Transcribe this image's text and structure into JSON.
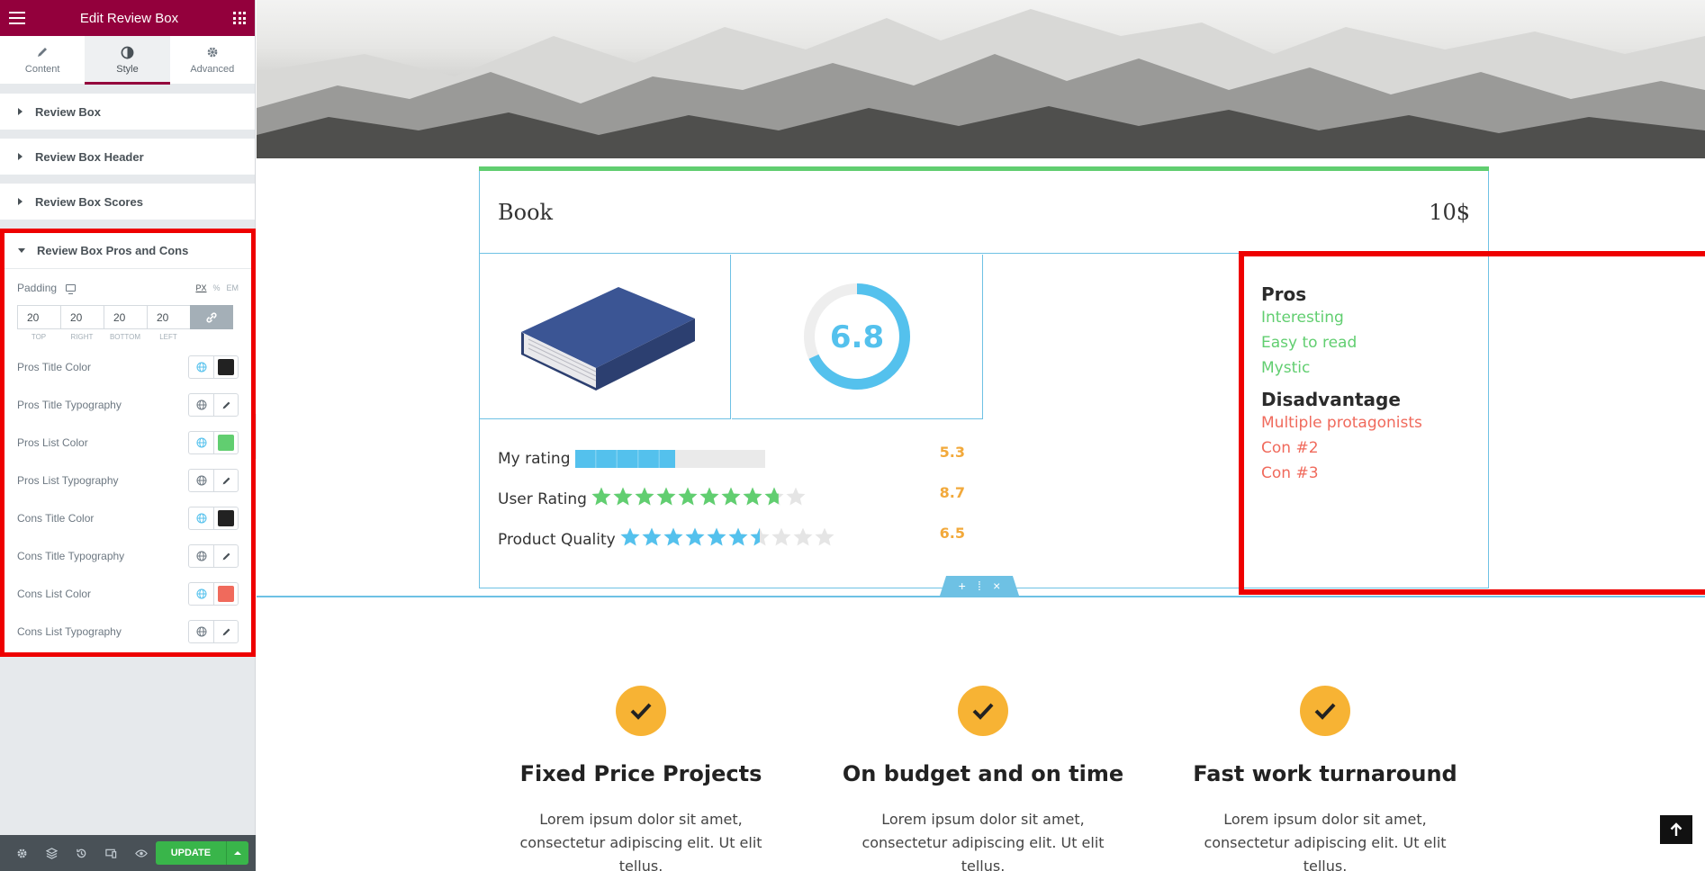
{
  "sidebar": {
    "title": "Edit Review Box",
    "tabs": [
      {
        "label": "Content",
        "icon": "pencil-icon"
      },
      {
        "label": "Style",
        "icon": "contrast-icon"
      },
      {
        "label": "Advanced",
        "icon": "gear-icon"
      }
    ],
    "sections": [
      "Review Box",
      "Review Box Header",
      "Review Box Scores"
    ],
    "open_section": {
      "title": "Review Box Pros and Cons",
      "padding": {
        "label": "Padding",
        "units": [
          "PX",
          "%",
          "EM"
        ],
        "values": [
          "20",
          "20",
          "20",
          "20"
        ],
        "labels": [
          "TOP",
          "RIGHT",
          "BOTTOM",
          "LEFT"
        ]
      },
      "controls": [
        {
          "label": "Pros Title Color",
          "type": "color",
          "color": "#222222"
        },
        {
          "label": "Pros Title Typography",
          "type": "typography"
        },
        {
          "label": "Pros List Color",
          "type": "color",
          "color": "#61ce70"
        },
        {
          "label": "Pros List Typography",
          "type": "typography"
        },
        {
          "label": "Cons Title Color",
          "type": "color",
          "color": "#222222"
        },
        {
          "label": "Cons Title Typography",
          "type": "typography"
        },
        {
          "label": "Cons List Color",
          "type": "color",
          "color": "#f06a5c"
        },
        {
          "label": "Cons List Typography",
          "type": "typography"
        }
      ]
    },
    "footer": {
      "update_label": "UPDATE"
    }
  },
  "review": {
    "title": "Book",
    "price": "10$",
    "score": "6.8",
    "score_fraction": 0.68,
    "ratings": [
      {
        "label": "My rating",
        "value": "5.3",
        "type": "bar",
        "fraction": 0.53
      },
      {
        "label": "User Rating",
        "value": "8.7",
        "type": "stars",
        "color": "#61ce70",
        "stars": 8.7
      },
      {
        "label": "Product Quality",
        "value": "6.5",
        "type": "stars",
        "color": "#54c1ed",
        "stars": 6.5
      }
    ],
    "pros": {
      "title": "Pros",
      "items": [
        "Interesting",
        "Easy to read",
        "Mystic"
      ]
    },
    "cons": {
      "title": "Disadvantage",
      "items": [
        "Multiple protagonists",
        "Con #2",
        "Con #3"
      ]
    }
  },
  "features": [
    {
      "title": "Fixed Price Projects",
      "text": "Lorem ipsum dolor sit amet, consectetur adipiscing elit. Ut elit tellus."
    },
    {
      "title": "On budget and on time",
      "text": "Lorem ipsum dolor sit amet, consectetur adipiscing elit. Ut elit tellus."
    },
    {
      "title": "Fast work turnaround",
      "text": "Lorem ipsum dolor sit amet, consectetur adipiscing elit. Ut elit tellus."
    }
  ],
  "colors": {
    "brand": "#93003c",
    "accent": "#6ec1e4",
    "update": "#39b54a",
    "highlight": "#ee0000"
  }
}
